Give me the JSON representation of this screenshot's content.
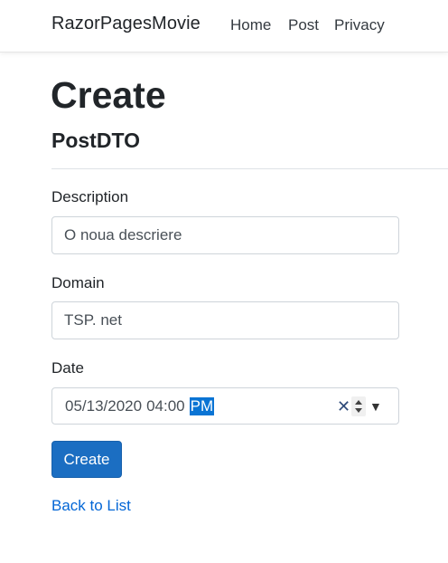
{
  "navbar": {
    "brand": "RazorPagesMovie",
    "links": [
      {
        "label": "Home"
      },
      {
        "label": "Post"
      },
      {
        "label": "Privacy"
      }
    ]
  },
  "page": {
    "title": "Create",
    "subtitle": "PostDTO"
  },
  "form": {
    "description": {
      "label": "Description",
      "value": "O noua descriere"
    },
    "domain": {
      "label": "Domain",
      "value": "TSP. net"
    },
    "date": {
      "label": "Date",
      "date_part": "05/13/2020",
      "time_part": "04:00",
      "ampm_part": "PM",
      "clear_symbol": "✕",
      "dropdown_symbol": "▼"
    },
    "submit_label": "Create"
  },
  "back_link": "Back to List",
  "colors": {
    "primary_button": "#1b6ec2",
    "link": "#0366d6",
    "selection": "#0a74d4"
  },
  "icons": [
    "clear-icon",
    "spin-icon",
    "dropdown-icon"
  ]
}
